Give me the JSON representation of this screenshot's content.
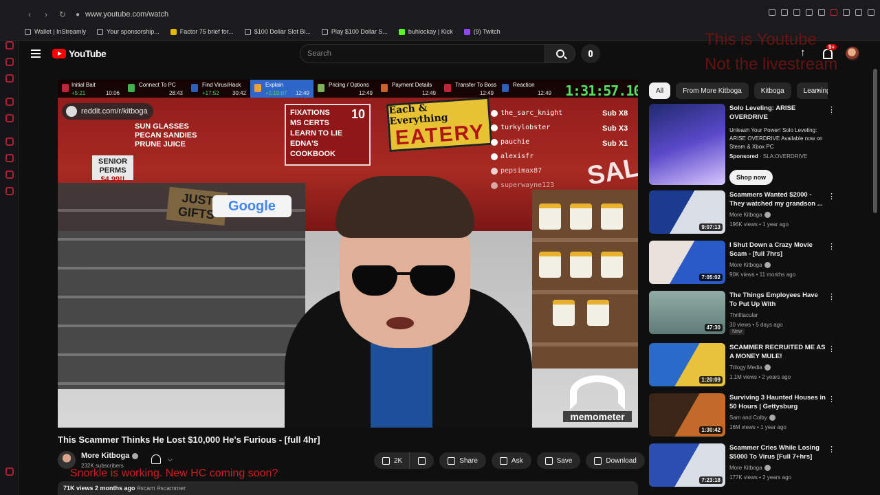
{
  "browser": {
    "url": "www.youtube.com/watch",
    "bookmarks": [
      {
        "label": "Wallet | InStreamly",
        "icon": "page-icon"
      },
      {
        "label": "Your sponsorship...",
        "icon": "page-icon"
      },
      {
        "label": "Factor 75 brief for...",
        "icon": "doc-icon"
      },
      {
        "label": "$100 Dollar Slot Bi...",
        "icon": "page-icon"
      },
      {
        "label": "Play $100 Dollar S...",
        "icon": "page-icon"
      },
      {
        "label": "buhlockay | Kick",
        "icon": "kick-icon"
      },
      {
        "label": "(9) Twitch",
        "icon": "twitch-icon"
      }
    ]
  },
  "header": {
    "logo_text": "YouTube",
    "search_placeholder": "Search",
    "notifications_badge": "9+",
    "overlay_note": "This is Youtube\nNot the livestream"
  },
  "video": {
    "splits": [
      {
        "name": "Initial Bait",
        "delta": "+5:21",
        "time": "10:06",
        "color": "#c0243a"
      },
      {
        "name": "Connect To PC",
        "delta": "",
        "time": "28:43",
        "color": "#3cb44b"
      },
      {
        "name": "Find Virus/Hack",
        "delta": "+17:52",
        "time": "30:42",
        "color": "#2b5fb8"
      },
      {
        "name": "Explain",
        "delta": "+1:19:07",
        "time": "12:49",
        "color": "#e8a33a"
      },
      {
        "name": "Pricing / Options",
        "delta": "",
        "time": "12:49",
        "color": "#7fb35a"
      },
      {
        "name": "Payment Details",
        "delta": "",
        "time": "12:49",
        "color": "#c8642a"
      },
      {
        "name": "Transfer To Boss",
        "delta": "",
        "time": "12:49",
        "color": "#c0243a"
      },
      {
        "name": "Reaction",
        "delta": "",
        "time": "12:49",
        "color": "#2b5fb8"
      }
    ],
    "timer": "1:31:57.10",
    "reddit": "reddit.com/r/kitboga",
    "chat": [
      "the_sarc_knight",
      "turkylobster",
      "pauchie",
      "alexisfr",
      "pepsimax87",
      "superwayne123"
    ],
    "subs": [
      "Sub X8",
      "Sub X3",
      "Sub X1"
    ],
    "watermark": "memometer",
    "scene": {
      "eatery_top": "Each & Everything",
      "eatery": "EATERY",
      "list": [
        "FIXATIONS",
        "MS CERTS",
        "LEARN TO LIE",
        "EDNA'S COOKBOOK"
      ],
      "list_num": "10",
      "sun": [
        "SUN GLASSES",
        "PECAN SANDIES",
        "PRUNE JUICE"
      ],
      "senior": [
        "SENIOR",
        "PERMS",
        "$4.99!!"
      ],
      "gifts": "JUST GIFTS",
      "google": "Google",
      "sale": "SALE!"
    }
  },
  "title": "This Scammer Thinks He Lost $10,000 He's Furious - [full 4hr]",
  "channel": {
    "name": "More Kitboga",
    "subscribers": "232K subscribers"
  },
  "red_note": "Snorkle is working. New HC coming soon?",
  "actions": {
    "likes": "2K",
    "share": "Share",
    "ask": "Ask",
    "save": "Save",
    "download": "Download"
  },
  "description": {
    "views": "71K views",
    "age": "2 months ago",
    "tags": "#scam #scammer"
  },
  "chips": [
    "All",
    "From More Kitboga",
    "Kitboga",
    "Learning"
  ],
  "ad": {
    "title": "Solo Leveling: ARISE OVERDRIVE",
    "desc": "Unleash Your Power! Solo Leveling: ARISE OVERDRIVE Available now on Steam & Xbox PC",
    "sponsored": "Sponsored",
    "advertiser": "· SLA:OVERDRIVE",
    "cta": "Shop now"
  },
  "recommendations": [
    {
      "title": "Scammers Wanted $2000 - They watched my grandson ...",
      "channel": "More Kitboga",
      "meta": "196K views • 1 year ago",
      "duration": "9:07:13",
      "colorA": "#1a3b8f",
      "colorB": "#d9dde6"
    },
    {
      "title": "I Shut Down a Crazy Movie Scam - [full 7hrs]",
      "channel": "More Kitboga",
      "meta": "90K views • 11 months ago",
      "duration": "7:05:02",
      "colorA": "#2a59c8",
      "colorB": "#e9e2dc"
    },
    {
      "title": "The Things Employees Have To Put Up With",
      "channel": "Thrilltacular",
      "meta": "30 views • 5 days ago",
      "duration": "47:30",
      "colorA": "#5f7c78",
      "colorB": "#92aba5",
      "new": "New"
    },
    {
      "title": "SCAMMER RECRUITED ME AS A MONEY MULE!",
      "channel": "Trilogy Media",
      "meta": "1.1M views • 2 years ago",
      "duration": "1:20:09",
      "colorA": "#2a6ac9",
      "colorB": "#e8c23a"
    },
    {
      "title": "Surviving 3 Haunted Houses in 50 Hours | Gettysburg",
      "channel": "Sam and Colby",
      "meta": "16M views • 1 year ago",
      "duration": "1:30:42",
      "colorA": "#3b2418",
      "colorB": "#c26a2a"
    },
    {
      "title": "Scammer Cries While Losing $5000 To Virus [Full 7+hrs]",
      "channel": "More Kitboga",
      "meta": "177K views • 2 years ago",
      "duration": "7:23:18",
      "colorA": "#2a4fb0",
      "colorB": "#d9dde6"
    }
  ],
  "colors": {
    "accent": "#ff0000",
    "background": "#0f0f0f",
    "chip": "#272727",
    "timer": "#54e35f"
  }
}
